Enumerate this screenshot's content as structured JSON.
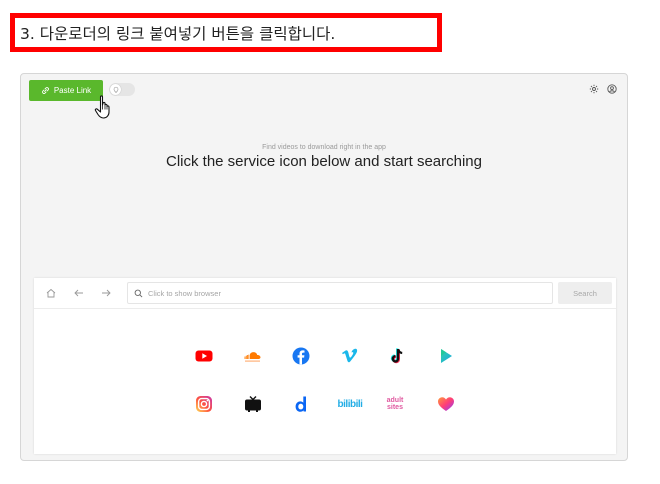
{
  "step": {
    "text": "3. 다운로더의 링크 붙여넣기 버튼을 클릭합니다."
  },
  "toolbar": {
    "paste_link_label": "Paste Link"
  },
  "hero": {
    "subtitle": "Find videos to download right in the app",
    "title": "Click the service icon below and start searching"
  },
  "browser": {
    "url_placeholder": "Click to show browser",
    "search_label": "Search"
  },
  "services": {
    "row1": [
      "youtube",
      "soundcloud",
      "facebook",
      "vimeo",
      "tiktok",
      "likee"
    ],
    "row2": [
      "instagram",
      "tv",
      "dailymotion",
      "bilibili",
      "adult-sites",
      "likee-heart"
    ],
    "bilibili_text": "bilibili",
    "adult_line1": "adult",
    "adult_line2": "sites"
  },
  "colors": {
    "accent": "#5ab82c",
    "banner": "#ff0000"
  }
}
